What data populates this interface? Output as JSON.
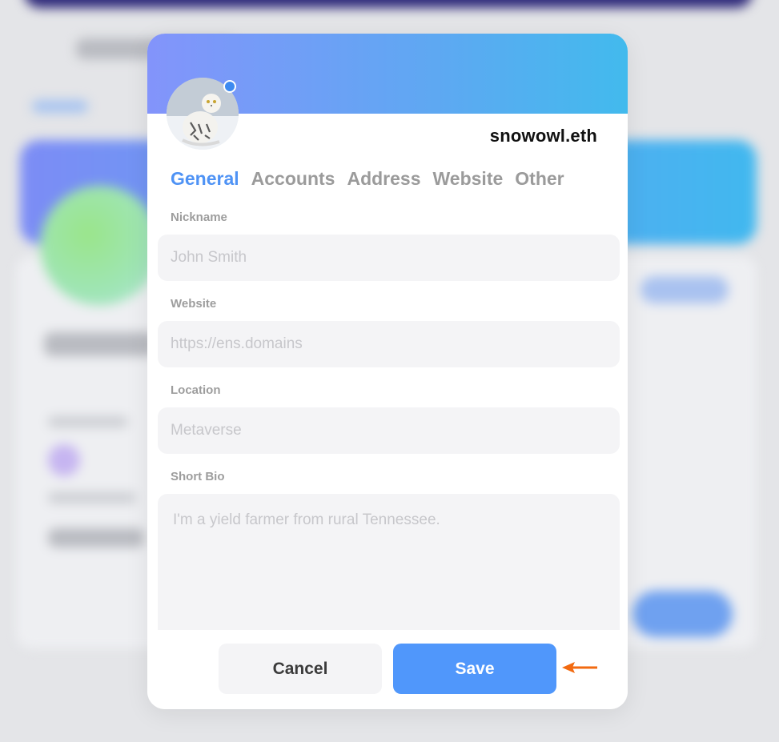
{
  "profile": {
    "ens_name": "snowowl.eth",
    "avatar_icon": "snowy-owl-avatar",
    "status_color": "#3d8af0"
  },
  "tabs": [
    {
      "label": "General",
      "active": true
    },
    {
      "label": "Accounts",
      "active": false
    },
    {
      "label": "Address",
      "active": false
    },
    {
      "label": "Website",
      "active": false
    },
    {
      "label": "Other",
      "active": false
    }
  ],
  "form": {
    "nickname": {
      "label": "Nickname",
      "placeholder": "John Smith",
      "value": ""
    },
    "website": {
      "label": "Website",
      "placeholder": "https://ens.domains",
      "value": ""
    },
    "location": {
      "label": "Location",
      "placeholder": "Metaverse",
      "value": ""
    },
    "bio": {
      "label": "Short Bio",
      "placeholder": "I'm a yield farmer from rural Tennessee.",
      "value": ""
    }
  },
  "buttons": {
    "cancel": "Cancel",
    "save": "Save"
  },
  "annotation": {
    "icon": "arrow-left-icon",
    "color": "#f26a10"
  },
  "colors": {
    "accent": "#4f93f5",
    "save_button": "#5097fb",
    "banner_start": "#8394fb",
    "banner_end": "#42baed"
  }
}
